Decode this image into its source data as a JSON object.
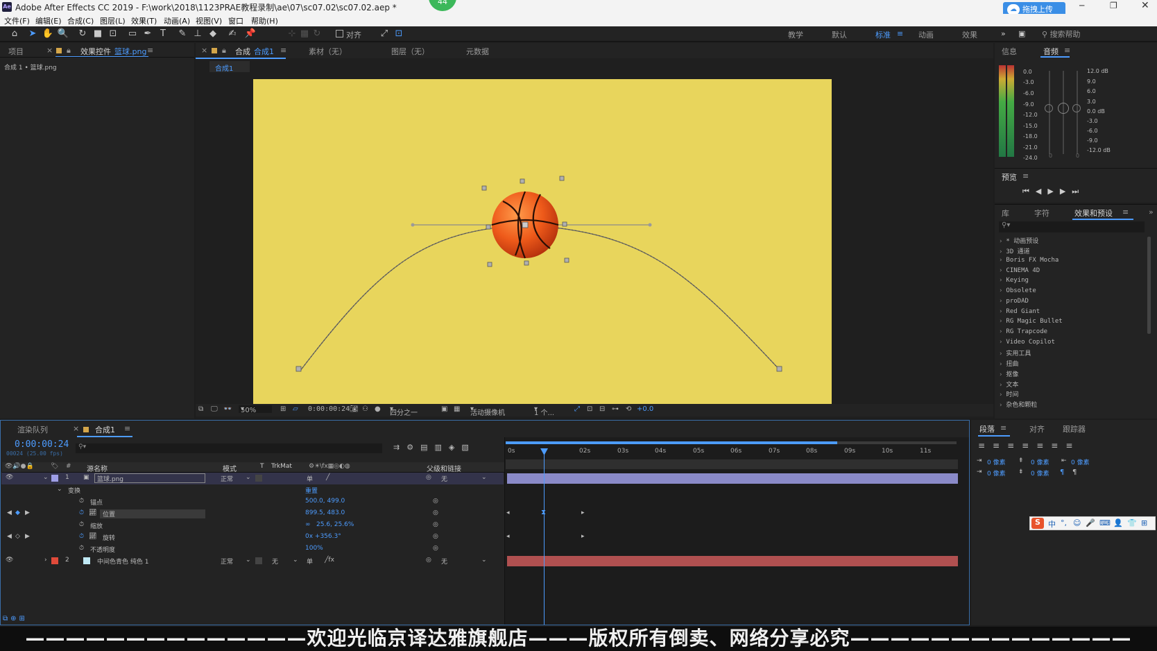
{
  "window": {
    "title": "Adobe After Effects CC 2019 - F:\\work\\2018\\1123PRAE教程录制\\ae\\07\\sc07.02\\sc07.02.aep *",
    "icon_text": "Ae",
    "badge": "44",
    "upload_label": "拖拽上传"
  },
  "menu": [
    "文件(F)",
    "编辑(E)",
    "合成(C)",
    "图层(L)",
    "效果(T)",
    "动画(A)",
    "视图(V)",
    "窗口",
    "帮助(H)"
  ],
  "toolbar": {
    "align_label": "对齐",
    "workspaces": [
      "教学",
      "默认",
      "标准",
      "动画",
      "效果"
    ],
    "active_workspace": "标准",
    "search_placeholder": "搜索帮助"
  },
  "left_panel": {
    "tab_project": "项目",
    "tab_effects_prefix": "效果控件",
    "tab_effects_layer": "篮球.png",
    "breadcrumb": "合成 1 • 篮球.png"
  },
  "viewer": {
    "tab_comp_prefix": "合成",
    "tab_comp_name": "合成1",
    "tab_footage": "素材（无）",
    "tab_layer": "图层（无）",
    "tab_meta": "元数据",
    "comp_chip": "合成1",
    "zoom": "50%",
    "timecode": "0:00:00:24",
    "resolution": "四分之一",
    "camera": "活动摄像机",
    "views": "1 个...",
    "exposure": "+0.0"
  },
  "info_panel": {
    "tab_info": "信息",
    "tab_audio": "音频",
    "meter_scale": [
      "0.0",
      "-3.0",
      "-6.0",
      "-9.0",
      "-12.0",
      "-15.0",
      "-18.0",
      "-21.0",
      "-24.0"
    ],
    "db_scale": [
      "12.0 dB",
      "9.0",
      "6.0",
      "3.0",
      "0.0 dB",
      "-3.0",
      "-6.0",
      "-9.0",
      "-12.0 dB"
    ],
    "meter_zero_left": "0",
    "meter_zero_right": "0"
  },
  "preview": {
    "title": "预览"
  },
  "effects_panel": {
    "tab_lib": "库",
    "tab_char": "字符",
    "tab_effects": "效果和预设",
    "items": [
      "* 动画预设",
      "3D 通道",
      "Boris FX Mocha",
      "CINEMA 4D",
      "Keying",
      "Obsolete",
      "proDAD",
      "Red Giant",
      "RG Magic Bullet",
      "RG Trapcode",
      "Video Copilot",
      "实用工具",
      "扭曲",
      "抠像",
      "文本",
      "时间",
      "杂色和颗粒"
    ]
  },
  "paragraph_panel": {
    "tab_para": "段落",
    "tab_align": "对齐",
    "tab_tracker": "跟踪器",
    "fields": [
      "0 像素",
      "0 像素",
      "0 像素",
      "0 像素",
      "0 像素"
    ]
  },
  "timeline": {
    "tab_render": "渲染队列",
    "tab_comp": "合成1",
    "timecode": "0:00:00:24",
    "subcode": "00024 (25.00 fps)",
    "col_name": "源名称",
    "col_mode": "模式",
    "col_t": "T",
    "col_trkmat": "TrkMat",
    "col_parent": "父级和链接",
    "ruler": [
      "0s",
      "02s",
      "03s",
      "04s",
      "05s",
      "06s",
      "07s",
      "08s",
      "09s",
      "10s",
      "11s"
    ],
    "layers": [
      {
        "num": "1",
        "name": "篮球.png",
        "mode": "正常",
        "parent": "无",
        "color": "#9e9ee6"
      },
      {
        "num": "2",
        "name": "中间色青色 纯色 1",
        "mode": "正常",
        "trkmat": "无",
        "parent": "无",
        "color": "#e04a3a"
      }
    ],
    "transform_label": "变换",
    "reset_label": "重置",
    "props": [
      {
        "name": "锚点",
        "value": "500.0, 499.0"
      },
      {
        "name": "位置",
        "value": "899.5, 483.0"
      },
      {
        "name": "缩放",
        "value": "25.6, 25.6%"
      },
      {
        "name": "旋转",
        "value": "0x +356.3°"
      },
      {
        "name": "不透明度",
        "value": "100%"
      }
    ]
  },
  "caption": "——————————————欢迎光临京译达雅旗舰店———版权所有倒卖、网络分享必究——————————————",
  "ime": [
    "中",
    "°,",
    "☺",
    "🎤",
    "⌨",
    "👤",
    "👕",
    "⊞"
  ],
  "colors": {
    "comp_bg": "#e8d55c",
    "accent": "#4d9cff",
    "layer1_bar": "#9e9ee6",
    "layer2_bar": "#b05050"
  }
}
